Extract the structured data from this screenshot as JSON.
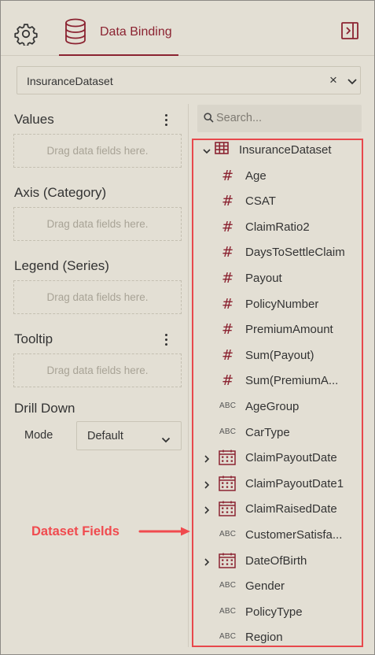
{
  "header": {
    "settings_icon": "gear-icon",
    "tab_label": "Data Binding",
    "tab_icon": "database-icon",
    "collapse_icon": "panel-collapse-icon",
    "accent_color": "#8b2331"
  },
  "dataset_select": {
    "value": "InsuranceDataset",
    "clear_glyph": "×"
  },
  "sections": {
    "values": {
      "title": "Values",
      "placeholder": "Drag data fields here."
    },
    "axis": {
      "title": "Axis (Category)",
      "placeholder": "Drag data fields here."
    },
    "legend": {
      "title": "Legend (Series)",
      "placeholder": "Drag data fields here."
    },
    "tooltip": {
      "title": "Tooltip",
      "placeholder": "Drag data fields here."
    },
    "drill_down": {
      "title": "Drill Down",
      "mode_label": "Mode",
      "mode_value": "Default"
    }
  },
  "search": {
    "placeholder": "Search..."
  },
  "tree": {
    "root": "InsuranceDataset",
    "fields": [
      {
        "label": "Age",
        "type": "number"
      },
      {
        "label": "CSAT",
        "type": "number"
      },
      {
        "label": "ClaimRatio2",
        "type": "number"
      },
      {
        "label": "DaysToSettleClaim",
        "type": "number"
      },
      {
        "label": "Payout",
        "type": "number"
      },
      {
        "label": "PolicyNumber",
        "type": "number"
      },
      {
        "label": "PremiumAmount",
        "type": "number"
      },
      {
        "label": "Sum(Payout)",
        "type": "number"
      },
      {
        "label": "Sum(PremiumA...",
        "type": "number"
      },
      {
        "label": "AgeGroup",
        "type": "text"
      },
      {
        "label": "CarType",
        "type": "text"
      },
      {
        "label": "ClaimPayoutDate",
        "type": "date"
      },
      {
        "label": "ClaimPayoutDate1",
        "type": "date"
      },
      {
        "label": "ClaimRaisedDate",
        "type": "date"
      },
      {
        "label": "CustomerSatisfa...",
        "type": "text"
      },
      {
        "label": "DateOfBirth",
        "type": "date"
      },
      {
        "label": "Gender",
        "type": "text"
      },
      {
        "label": "PolicyType",
        "type": "text"
      },
      {
        "label": "Region",
        "type": "text"
      }
    ],
    "number_glyph": "#",
    "text_glyph": "ABC"
  },
  "annotation": {
    "label": "Dataset Fields",
    "color": "#f04a4e"
  }
}
